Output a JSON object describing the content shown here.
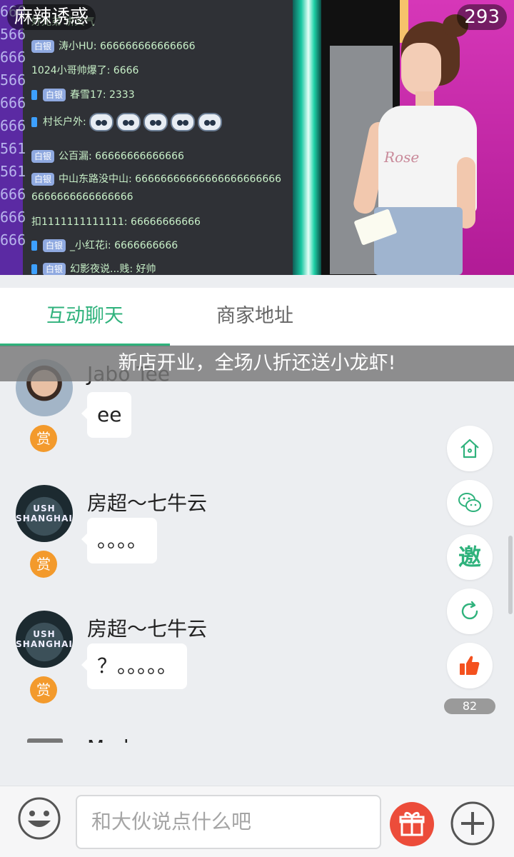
{
  "header": {
    "room_title": "麻辣诱惑",
    "viewer_count": "293"
  },
  "video": {
    "danmaku": [
      {
        "text": "好兄弟 讲义气"
      },
      {
        "badge": "白银",
        "text": "涛小HU: 666666666666666"
      },
      {
        "text": "1024小哥帅爆了: 6666"
      },
      {
        "badge": "白银",
        "text": "春雪17: 2333"
      },
      {
        "badge": "",
        "text": "村长户外:"
      },
      {
        "badge": "白银",
        "text": "公百漏: 66666666666666"
      },
      {
        "badge": "白银",
        "text": "中山东路没中山: 66666666666666666666666"
      },
      {
        "text": "6666666666666666"
      },
      {
        "text": "扣1111111111111: 66666666666"
      },
      {
        "badge": "白银",
        "text": "_小红花i: 6666666666"
      },
      {
        "badge": "白银",
        "text": "幻影夜说...贱: 好帅"
      }
    ],
    "shirt_text": "Rose"
  },
  "tabs": {
    "items": [
      {
        "label": "互动聊天",
        "active": true
      },
      {
        "label": "商家地址",
        "active": false
      }
    ]
  },
  "marquee": {
    "text": "新店开业，全场八折还送小龙虾!"
  },
  "chat": {
    "reward_label": "赏",
    "messages": [
      {
        "nickname": "Jabo Tee",
        "content": "ee"
      },
      {
        "nickname": "房超～七牛云",
        "content": "。。。。"
      },
      {
        "nickname": "房超～七牛云",
        "content": "？。。。。。"
      }
    ],
    "partial_nickname": "M...l..."
  },
  "side_actions": {
    "invite_label": "邀",
    "like_count": "82"
  },
  "input": {
    "placeholder": "和大伙说点什么吧"
  },
  "colors": {
    "accent": "#2fb27c",
    "reward": "#f39a2c",
    "gift": "#ec4c3a",
    "like": "#f4511e"
  }
}
